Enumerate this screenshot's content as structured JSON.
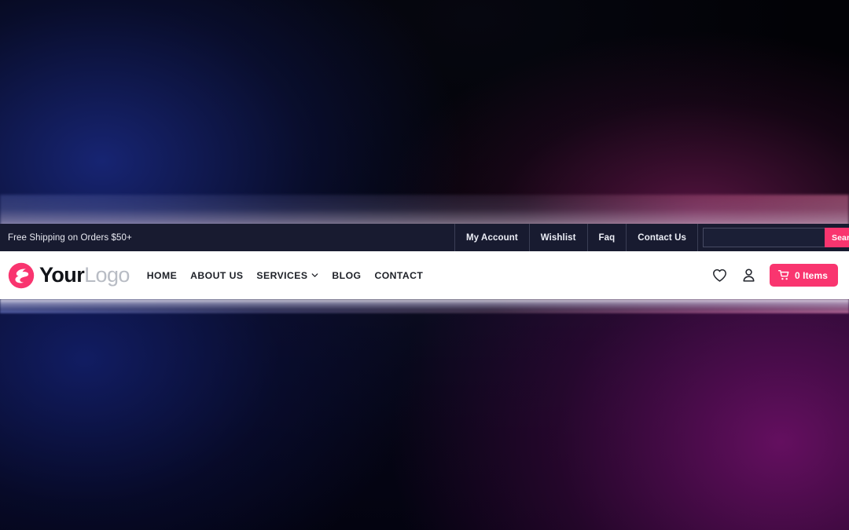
{
  "topbar": {
    "promo": "Free Shipping on Orders $50+",
    "links": [
      {
        "label": "My Account",
        "name": "my-account"
      },
      {
        "label": "Wishlist",
        "name": "wishlist"
      },
      {
        "label": "Faq",
        "name": "faq"
      },
      {
        "label": "Contact Us",
        "name": "contact-us"
      }
    ],
    "search": {
      "value": "",
      "placeholder": "",
      "button_label": "Search"
    }
  },
  "header": {
    "logo": {
      "text_primary": "Your",
      "text_secondary": "Logo",
      "mark": "lightning-circle-icon"
    },
    "nav": [
      {
        "label": "HOME",
        "name": "home",
        "has_dropdown": false
      },
      {
        "label": "ABOUT US",
        "name": "about-us",
        "has_dropdown": false
      },
      {
        "label": "SERVICES",
        "name": "services",
        "has_dropdown": true
      },
      {
        "label": "BLOG",
        "name": "blog",
        "has_dropdown": false
      },
      {
        "label": "CONTACT",
        "name": "contact",
        "has_dropdown": false
      }
    ],
    "actions": {
      "wishlist_icon": "heart-icon",
      "account_icon": "user-icon",
      "cart_label": "0 Items",
      "cart_icon": "shopping-cart-icon"
    }
  },
  "colors": {
    "accent_pink": "#F9356F",
    "topbar_bg": "#181B30",
    "header_bg": "#FFFFFF",
    "logo_gray": "#B8BCC4",
    "nav_text": "#1C1F26"
  }
}
